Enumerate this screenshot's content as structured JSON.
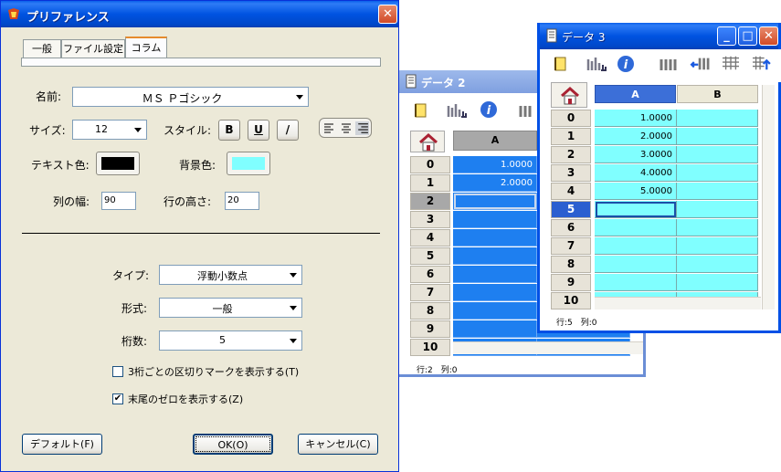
{
  "pref_dialog": {
    "title": "プリファレンス",
    "tabs": [
      "一般",
      "ファイル設定",
      "コラム"
    ],
    "name_label": "名前:",
    "name_value": "ＭＳ Ｐゴシック",
    "size_label": "サイズ:",
    "size_value": "12",
    "style_label": "スタイル:",
    "style_bold": "B",
    "style_underline": "U",
    "style_italic": "/",
    "text_color_label": "テキスト色:",
    "bg_color_label": "背景色:",
    "text_color": "#000000",
    "bg_color": "#80ffff",
    "col_width_label": "列の幅:",
    "col_width_value": "90",
    "row_height_label": "行の高さ:",
    "row_height_value": "20",
    "type_label": "タイプ:",
    "type_value": "浮動小数点",
    "format_label": "形式:",
    "format_value": "一般",
    "digits_label": "桁数:",
    "digits_value": "5",
    "thousands_label": "3桁ごとの区切りマークを表示する(T)",
    "trailing_zero_label": "末尾のゼロを表示する(Z)",
    "default_button": "デフォルト(F)",
    "ok_button": "OK(O)",
    "cancel_button": "キャンセル(C)"
  },
  "data2": {
    "title": "データ 2",
    "col_a": "A",
    "rows": [
      "0",
      "1",
      "2",
      "3",
      "4",
      "5",
      "6",
      "7",
      "8",
      "9",
      "10"
    ],
    "values": [
      "1.0000",
      "2.0000"
    ],
    "status": "行:2　列:0"
  },
  "data3": {
    "title": "データ 3",
    "col_a": "A",
    "col_b": "B",
    "rows": [
      "0",
      "1",
      "2",
      "3",
      "4",
      "5",
      "6",
      "7",
      "8",
      "9",
      "10"
    ],
    "values": [
      "1.0000",
      "2.0000",
      "3.0000",
      "4.0000",
      "5.0000"
    ],
    "status": "行:5　列:0"
  }
}
